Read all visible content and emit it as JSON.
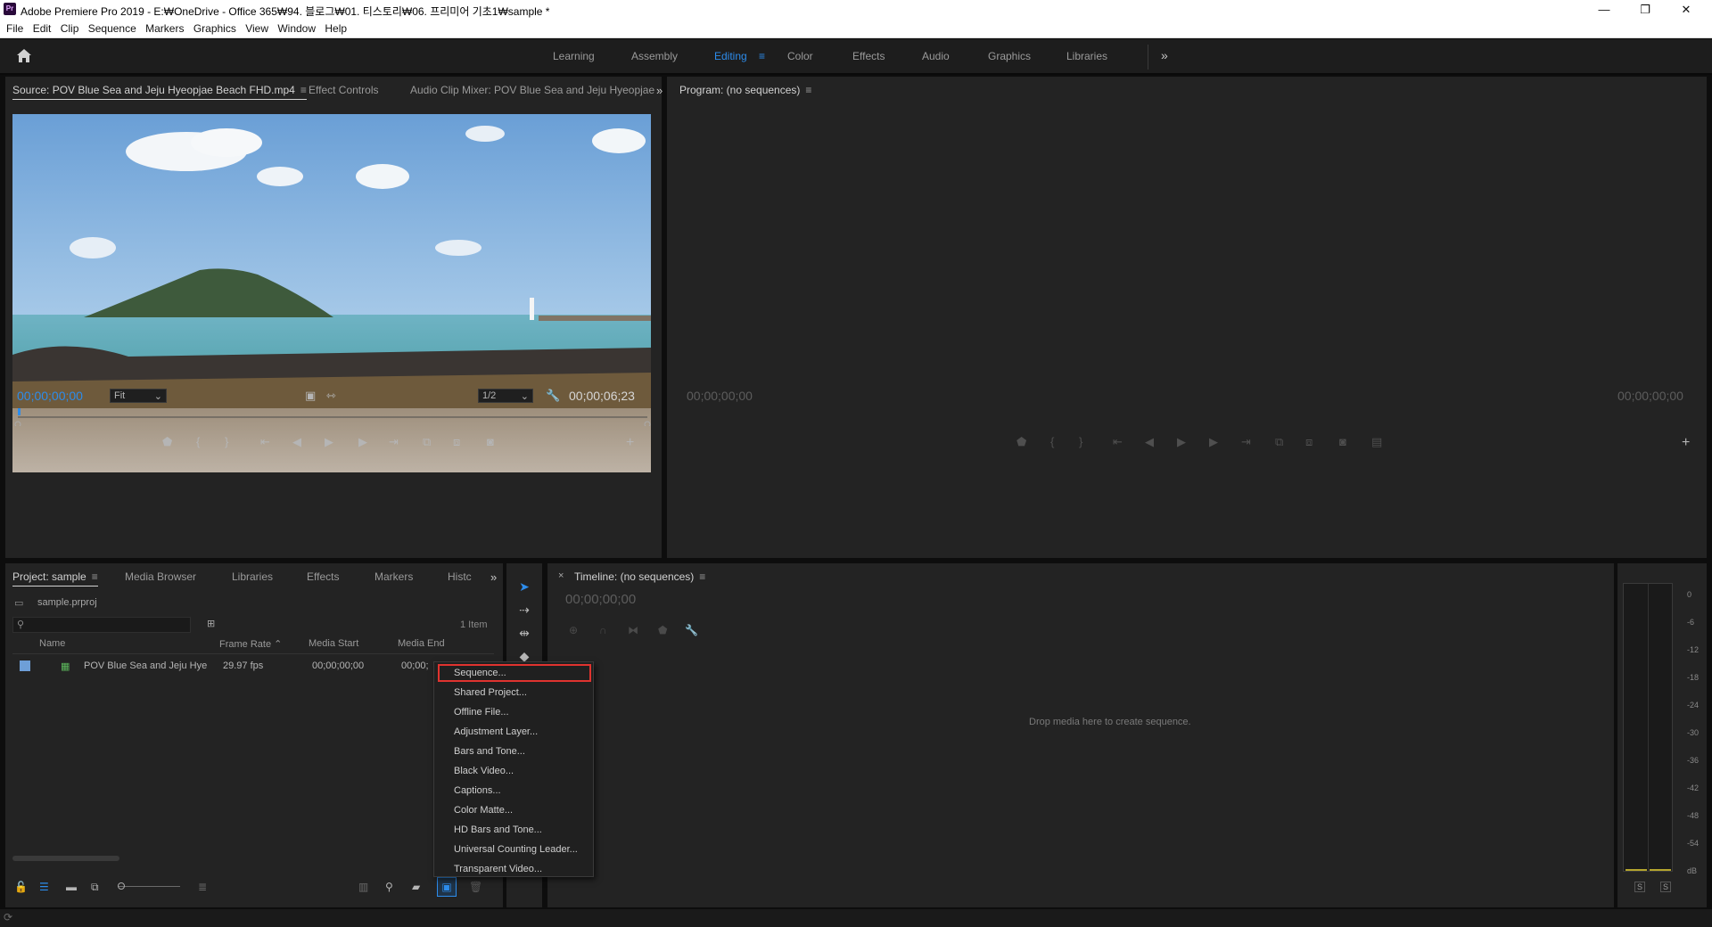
{
  "window": {
    "title": "Adobe Premiere Pro 2019 - E:₩OneDrive - Office 365₩94. 블로그₩01. 티스토리₩06. 프리미어 기초1₩sample *",
    "app_icon": "Pr",
    "controls": {
      "minimize": "—",
      "restore": "❐",
      "close": "✕"
    }
  },
  "menubar": [
    "File",
    "Edit",
    "Clip",
    "Sequence",
    "Markers",
    "Graphics",
    "View",
    "Window",
    "Help"
  ],
  "workspaces": {
    "tabs": [
      "Learning",
      "Assembly",
      "Editing",
      "Color",
      "Effects",
      "Audio",
      "Graphics",
      "Libraries"
    ],
    "active": "Editing",
    "overflow": "»"
  },
  "source_monitor": {
    "tabs": [
      "Source: POV Blue Sea and Jeju Hyeopjae Beach FHD.mp4",
      "Effect Controls",
      "Audio Clip Mixer: POV Blue Sea and Jeju Hyeopjae"
    ],
    "timecode_in": "00;00;00;00",
    "zoom": "Fit",
    "resolution": "1/2",
    "duration": "00;00;06;23"
  },
  "program_monitor": {
    "title": "Program: (no sequences)",
    "timecode_left": "00;00;00;00",
    "timecode_right": "00;00;00;00"
  },
  "project_panel": {
    "tabs": [
      "Project: sample",
      "Media Browser",
      "Libraries",
      "Effects",
      "Markers",
      "Histc"
    ],
    "project_file": "sample.prproj",
    "item_count": "1 Item",
    "columns": [
      "Name",
      "Frame Rate",
      "Media Start",
      "Media End"
    ],
    "rows": [
      {
        "name": "POV Blue Sea and Jeju Hye",
        "frame_rate": "29.97 fps",
        "media_start": "00;00;00;00",
        "media_end": "00;00;"
      }
    ]
  },
  "timeline": {
    "title": "Timeline: (no sequences)",
    "close": "×",
    "timecode": "00;00;00;00",
    "empty_text": "Drop media here to create sequence."
  },
  "context_menu": {
    "items": [
      "Sequence...",
      "Shared Project...",
      "Offline File...",
      "Adjustment Layer...",
      "Bars and Tone...",
      "Black Video...",
      "Captions...",
      "Color Matte...",
      "HD Bars and Tone...",
      "Universal Counting Leader...",
      "Transparent Video..."
    ],
    "highlighted": "Sequence..."
  },
  "audio_meter": {
    "scale": [
      "0",
      "-6",
      "-12",
      "-18",
      "-24",
      "-30",
      "-36",
      "-42",
      "-48",
      "-54",
      "dB"
    ],
    "solo_labels": [
      "S",
      "S"
    ]
  },
  "colors": {
    "accent": "#2d8ceb",
    "highlight_border": "#e0332f",
    "panel_bg": "#232323"
  }
}
